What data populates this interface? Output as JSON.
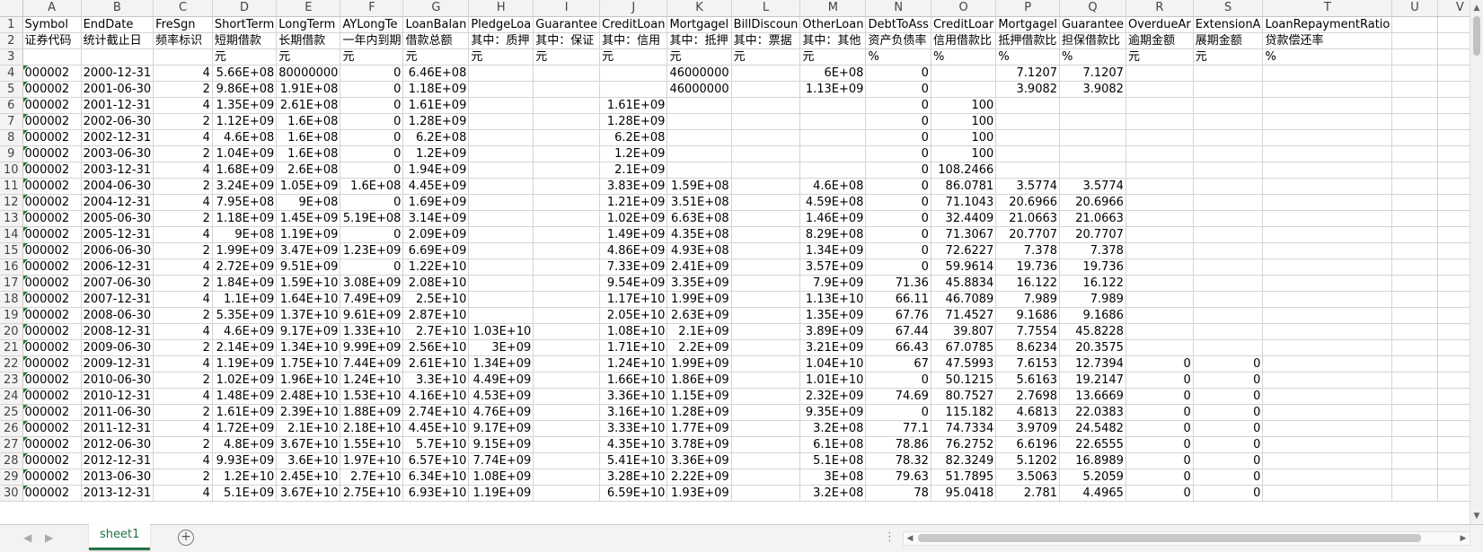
{
  "columns": [
    "A",
    "B",
    "C",
    "D",
    "E",
    "F",
    "G",
    "H",
    "I",
    "J",
    "K",
    "L",
    "M",
    "N",
    "O",
    "P",
    "Q",
    "R",
    "S",
    "T",
    "U",
    "V"
  ],
  "rows": [
    [
      "Symbol",
      "EndDate",
      "FreSgn",
      "ShortTerm",
      "LongTerm",
      "AYLongTe",
      "LoanBalan",
      "PledgeLoa",
      "Guarantee",
      "CreditLoan",
      "Mortgagel",
      "BillDiscoun",
      "OtherLoan",
      "DebtToAss",
      "CreditLoar",
      "Mortgagel",
      "Guarantee",
      "OverdueAr",
      "ExtensionA",
      "LoanRepaymentRatio",
      "",
      ""
    ],
    [
      "证券代码",
      "统计截止日",
      "频率标识",
      "短期借款",
      "长期借款",
      "一年内到期",
      "借款总额",
      "其中：质押",
      "其中：保证",
      "其中：信用",
      "其中：抵押",
      "其中：票据",
      "其中：其他",
      "资产负债率",
      "信用借款比",
      "抵押借款比",
      "担保借款比",
      "逾期金额",
      "展期金额",
      "贷款偿还率",
      "",
      ""
    ],
    [
      "",
      "",
      "",
      "元",
      "元",
      "元",
      "元",
      "元",
      "元",
      "元",
      "元",
      "元",
      "元",
      "%",
      "%",
      "%",
      "%",
      "元",
      "元",
      "%",
      "",
      ""
    ],
    [
      "000002",
      "2000-12-31",
      "4",
      "5.66E+08",
      "80000000",
      "0",
      "6.46E+08",
      "",
      "",
      "",
      "46000000",
      "",
      "6E+08",
      "0",
      "",
      "7.1207",
      "7.1207",
      "",
      "",
      "",
      "",
      ""
    ],
    [
      "000002",
      "2001-06-30",
      "2",
      "9.86E+08",
      "1.91E+08",
      "0",
      "1.18E+09",
      "",
      "",
      "",
      "46000000",
      "",
      "1.13E+09",
      "0",
      "",
      "3.9082",
      "3.9082",
      "",
      "",
      "",
      "",
      ""
    ],
    [
      "000002",
      "2001-12-31",
      "4",
      "1.35E+09",
      "2.61E+08",
      "0",
      "1.61E+09",
      "",
      "",
      "1.61E+09",
      "",
      "",
      "",
      "0",
      "100",
      "",
      "",
      "",
      "",
      "",
      "",
      ""
    ],
    [
      "000002",
      "2002-06-30",
      "2",
      "1.12E+09",
      "1.6E+08",
      "0",
      "1.28E+09",
      "",
      "",
      "1.28E+09",
      "",
      "",
      "",
      "0",
      "100",
      "",
      "",
      "",
      "",
      "",
      "",
      ""
    ],
    [
      "000002",
      "2002-12-31",
      "4",
      "4.6E+08",
      "1.6E+08",
      "0",
      "6.2E+08",
      "",
      "",
      "6.2E+08",
      "",
      "",
      "",
      "0",
      "100",
      "",
      "",
      "",
      "",
      "",
      "",
      ""
    ],
    [
      "000002",
      "2003-06-30",
      "2",
      "1.04E+09",
      "1.6E+08",
      "0",
      "1.2E+09",
      "",
      "",
      "1.2E+09",
      "",
      "",
      "",
      "0",
      "100",
      "",
      "",
      "",
      "",
      "",
      "",
      ""
    ],
    [
      "000002",
      "2003-12-31",
      "4",
      "1.68E+09",
      "2.6E+08",
      "0",
      "1.94E+09",
      "",
      "",
      "2.1E+09",
      "",
      "",
      "",
      "0",
      "108.2466",
      "",
      "",
      "",
      "",
      "",
      "",
      ""
    ],
    [
      "000002",
      "2004-06-30",
      "2",
      "3.24E+09",
      "1.05E+09",
      "1.6E+08",
      "4.45E+09",
      "",
      "",
      "3.83E+09",
      "1.59E+08",
      "",
      "4.6E+08",
      "0",
      "86.0781",
      "3.5774",
      "3.5774",
      "",
      "",
      "",
      "",
      ""
    ],
    [
      "000002",
      "2004-12-31",
      "4",
      "7.95E+08",
      "9E+08",
      "0",
      "1.69E+09",
      "",
      "",
      "1.21E+09",
      "3.51E+08",
      "",
      "4.59E+08",
      "0",
      "71.1043",
      "20.6966",
      "20.6966",
      "",
      "",
      "",
      "",
      ""
    ],
    [
      "000002",
      "2005-06-30",
      "2",
      "1.18E+09",
      "1.45E+09",
      "5.19E+08",
      "3.14E+09",
      "",
      "",
      "1.02E+09",
      "6.63E+08",
      "",
      "1.46E+09",
      "0",
      "32.4409",
      "21.0663",
      "21.0663",
      "",
      "",
      "",
      "",
      ""
    ],
    [
      "000002",
      "2005-12-31",
      "4",
      "9E+08",
      "1.19E+09",
      "0",
      "2.09E+09",
      "",
      "",
      "1.49E+09",
      "4.35E+08",
      "",
      "8.29E+08",
      "0",
      "71.3067",
      "20.7707",
      "20.7707",
      "",
      "",
      "",
      "",
      ""
    ],
    [
      "000002",
      "2006-06-30",
      "2",
      "1.99E+09",
      "3.47E+09",
      "1.23E+09",
      "6.69E+09",
      "",
      "",
      "4.86E+09",
      "4.93E+08",
      "",
      "1.34E+09",
      "0",
      "72.6227",
      "7.378",
      "7.378",
      "",
      "",
      "",
      "",
      ""
    ],
    [
      "000002",
      "2006-12-31",
      "4",
      "2.72E+09",
      "9.51E+09",
      "0",
      "1.22E+10",
      "",
      "",
      "7.33E+09",
      "2.41E+09",
      "",
      "3.57E+09",
      "0",
      "59.9614",
      "19.736",
      "19.736",
      "",
      "",
      "",
      "",
      ""
    ],
    [
      "000002",
      "2007-06-30",
      "2",
      "1.84E+09",
      "1.59E+10",
      "3.08E+09",
      "2.08E+10",
      "",
      "",
      "9.54E+09",
      "3.35E+09",
      "",
      "7.9E+09",
      "71.36",
      "45.8834",
      "16.122",
      "16.122",
      "",
      "",
      "",
      "",
      ""
    ],
    [
      "000002",
      "2007-12-31",
      "4",
      "1.1E+09",
      "1.64E+10",
      "7.49E+09",
      "2.5E+10",
      "",
      "",
      "1.17E+10",
      "1.99E+09",
      "",
      "1.13E+10",
      "66.11",
      "46.7089",
      "7.989",
      "7.989",
      "",
      "",
      "",
      "",
      ""
    ],
    [
      "000002",
      "2008-06-30",
      "2",
      "5.35E+09",
      "1.37E+10",
      "9.61E+09",
      "2.87E+10",
      "",
      "",
      "2.05E+10",
      "2.63E+09",
      "",
      "1.35E+09",
      "67.76",
      "71.4527",
      "9.1686",
      "9.1686",
      "",
      "",
      "",
      "",
      ""
    ],
    [
      "000002",
      "2008-12-31",
      "4",
      "4.6E+09",
      "9.17E+09",
      "1.33E+10",
      "2.7E+10",
      "1.03E+10",
      "",
      "1.08E+10",
      "2.1E+09",
      "",
      "3.89E+09",
      "67.44",
      "39.807",
      "7.7554",
      "45.8228",
      "",
      "",
      "",
      "",
      ""
    ],
    [
      "000002",
      "2009-06-30",
      "2",
      "2.14E+09",
      "1.34E+10",
      "9.99E+09",
      "2.56E+10",
      "3E+09",
      "",
      "1.71E+10",
      "2.2E+09",
      "",
      "3.21E+09",
      "66.43",
      "67.0785",
      "8.6234",
      "20.3575",
      "",
      "",
      "",
      "",
      ""
    ],
    [
      "000002",
      "2009-12-31",
      "4",
      "1.19E+09",
      "1.75E+10",
      "7.44E+09",
      "2.61E+10",
      "1.34E+09",
      "",
      "1.24E+10",
      "1.99E+09",
      "",
      "1.04E+10",
      "67",
      "47.5993",
      "7.6153",
      "12.7394",
      "0",
      "0",
      "",
      "",
      ""
    ],
    [
      "000002",
      "2010-06-30",
      "2",
      "1.02E+09",
      "1.96E+10",
      "1.24E+10",
      "3.3E+10",
      "4.49E+09",
      "",
      "1.66E+10",
      "1.86E+09",
      "",
      "1.01E+10",
      "0",
      "50.1215",
      "5.6163",
      "19.2147",
      "0",
      "0",
      "",
      "",
      ""
    ],
    [
      "000002",
      "2010-12-31",
      "4",
      "1.48E+09",
      "2.48E+10",
      "1.53E+10",
      "4.16E+10",
      "4.53E+09",
      "",
      "3.36E+10",
      "1.15E+09",
      "",
      "2.32E+09",
      "74.69",
      "80.7527",
      "2.7698",
      "13.6669",
      "0",
      "0",
      "",
      "",
      ""
    ],
    [
      "000002",
      "2011-06-30",
      "2",
      "1.61E+09",
      "2.39E+10",
      "1.88E+09",
      "2.74E+10",
      "4.76E+09",
      "",
      "3.16E+10",
      "1.28E+09",
      "",
      "9.35E+09",
      "0",
      "115.182",
      "4.6813",
      "22.0383",
      "0",
      "0",
      "",
      "",
      ""
    ],
    [
      "000002",
      "2011-12-31",
      "4",
      "1.72E+09",
      "2.1E+10",
      "2.18E+10",
      "4.45E+10",
      "9.17E+09",
      "",
      "3.33E+10",
      "1.77E+09",
      "",
      "3.2E+08",
      "77.1",
      "74.7334",
      "3.9709",
      "24.5482",
      "0",
      "0",
      "",
      "",
      ""
    ],
    [
      "000002",
      "2012-06-30",
      "2",
      "4.8E+09",
      "3.67E+10",
      "1.55E+10",
      "5.7E+10",
      "9.15E+09",
      "",
      "4.35E+10",
      "3.78E+09",
      "",
      "6.1E+08",
      "78.86",
      "76.2752",
      "6.6196",
      "22.6555",
      "0",
      "0",
      "",
      "",
      ""
    ],
    [
      "000002",
      "2012-12-31",
      "4",
      "9.93E+09",
      "3.6E+10",
      "1.97E+10",
      "6.57E+10",
      "7.74E+09",
      "",
      "5.41E+10",
      "3.36E+09",
      "",
      "5.1E+08",
      "78.32",
      "82.3249",
      "5.1202",
      "16.8989",
      "0",
      "0",
      "",
      "",
      ""
    ],
    [
      "000002",
      "2013-06-30",
      "2",
      "1.2E+10",
      "2.45E+10",
      "2.7E+10",
      "6.34E+10",
      "1.08E+09",
      "",
      "3.28E+10",
      "2.22E+09",
      "",
      "3E+08",
      "79.63",
      "51.7895",
      "3.5063",
      "5.2059",
      "0",
      "0",
      "",
      "",
      ""
    ],
    [
      "000002",
      "2013-12-31",
      "4",
      "5.1E+09",
      "3.67E+10",
      "2.75E+10",
      "6.93E+10",
      "1.19E+09",
      "",
      "6.59E+10",
      "1.93E+09",
      "",
      "3.2E+08",
      "78",
      "95.0418",
      "2.781",
      "4.4965",
      "0",
      "0",
      "",
      "",
      ""
    ]
  ],
  "sheet_tab": "sheet1"
}
